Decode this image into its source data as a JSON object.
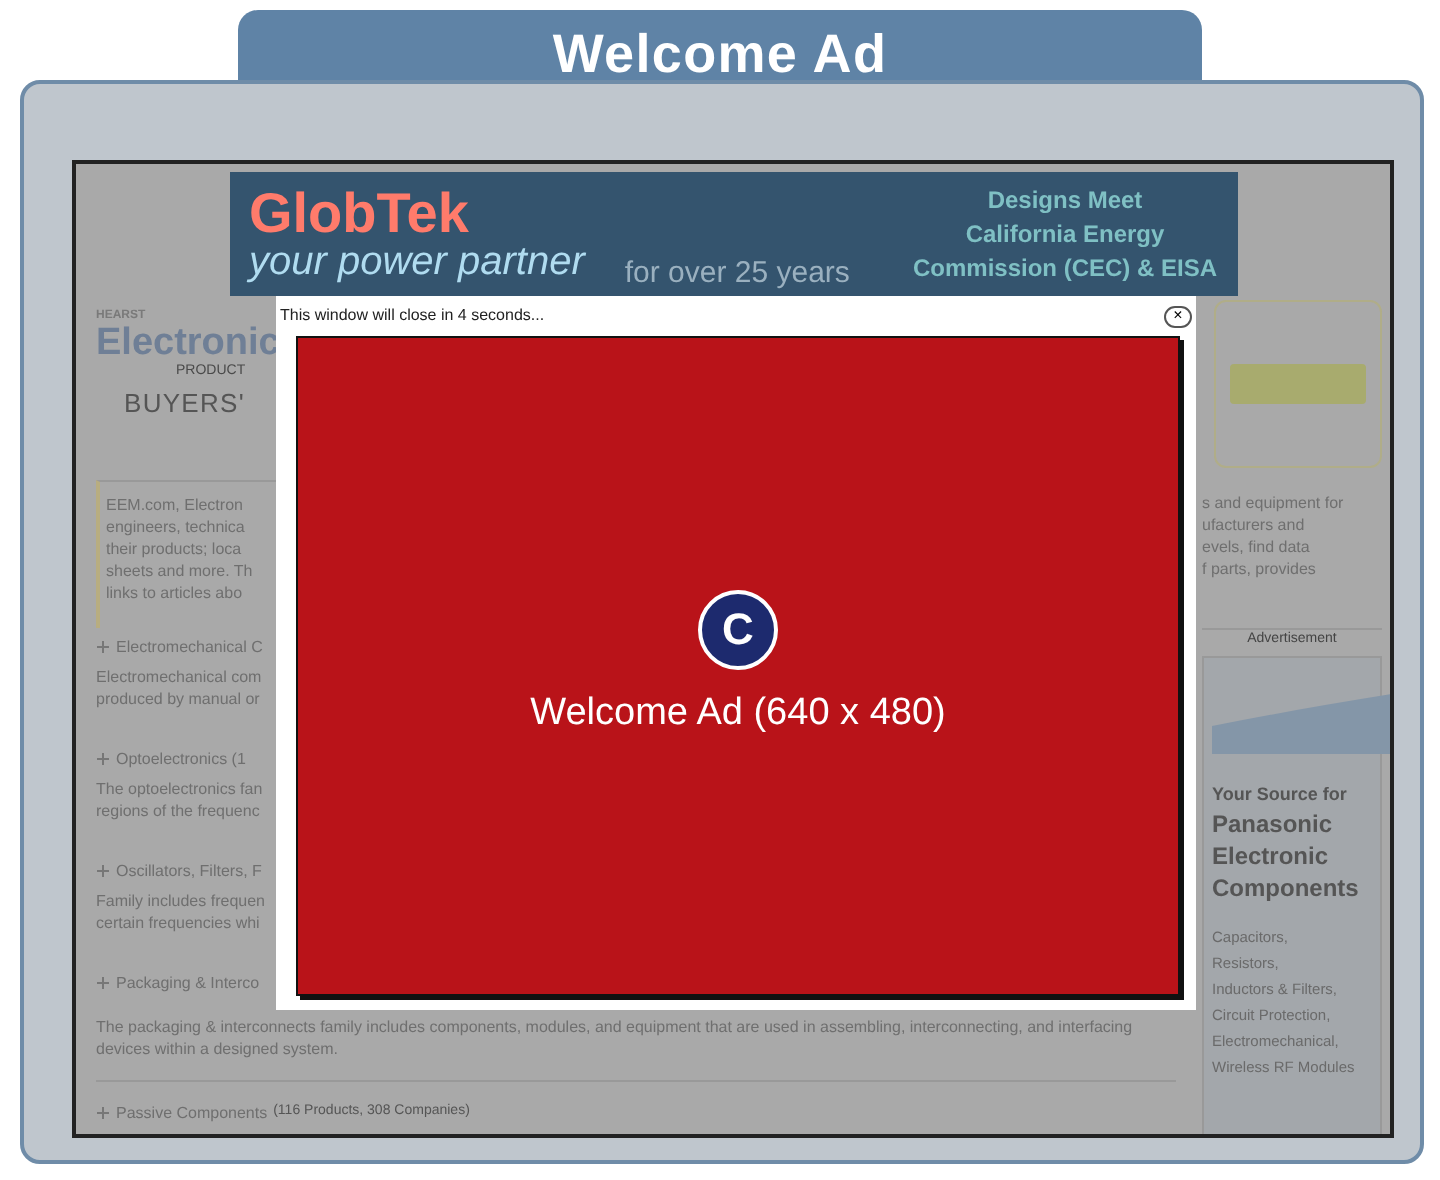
{
  "tab": {
    "title": "Welcome Ad"
  },
  "page": {
    "banner": {
      "brand": "GlobTek",
      "tagline": "your power partner",
      "years": "for over 25 years",
      "headline": [
        "Designs Meet",
        "California Energy",
        "Commission (CEC) & EISA"
      ]
    },
    "logo": {
      "publisher": "HEARST",
      "name": "Electronic",
      "sub": "PRODUCT",
      "buyers": "BUYERS'"
    },
    "intro_left": [
      "EEM.com, Electron",
      "engineers, technica",
      "their products; loca",
      "sheets and more. Th",
      "links to articles abo"
    ],
    "intro_right": [
      "s and equipment for",
      "ufacturers and",
      "evels, find data",
      "f parts, provides"
    ],
    "sections": [
      {
        "heading": "Electromechanical C",
        "lines": [
          "Electromechanical com",
          "produced by manual or"
        ]
      },
      {
        "heading": "Optoelectronics (1",
        "lines": [
          "The optoelectronics fan",
          "regions of the frequenc"
        ]
      },
      {
        "heading": "Oscillators, Filters, F",
        "lines": [
          "Family includes frequen",
          "certain frequencies whi"
        ]
      },
      {
        "heading": "Packaging & Interco"
      }
    ],
    "packaging_text": "The packaging & interconnects family includes components, modules, and equipment that are used in assembling, interconnecting, and interfacing devices within a designed system.",
    "last_section": {
      "heading": "Passive Components",
      "count": "(116 Products, 308 Companies)"
    },
    "side_ad": {
      "label": "Advertisement",
      "title": [
        "Your Source for",
        "Panasonic",
        "Electronic",
        "Components"
      ],
      "items": [
        "Capacitors,",
        "Resistors,",
        "Inductors & Filters,",
        "Circuit Protection,",
        "Electromechanical,",
        "Wireless RF Modules"
      ]
    }
  },
  "popup": {
    "notice": "This window will close in 4 seconds...",
    "close": "×",
    "badge": "C",
    "ad_label": "Welcome Ad (640 x 480)"
  }
}
